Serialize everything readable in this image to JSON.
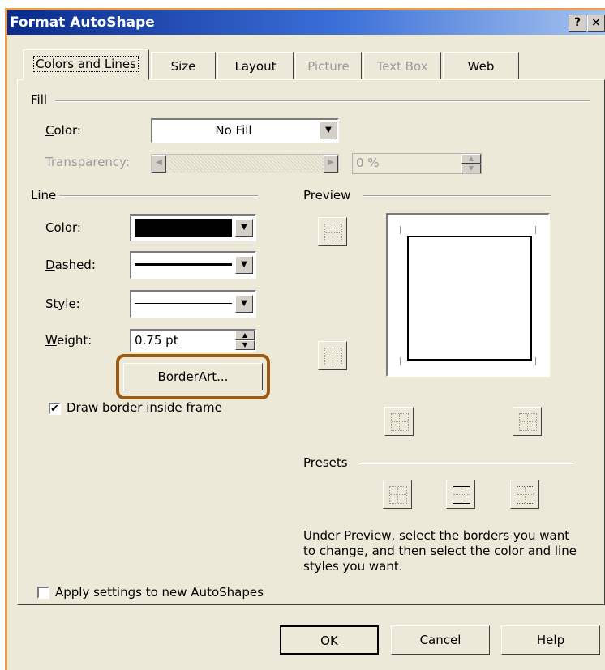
{
  "window": {
    "title": "Format AutoShape",
    "help_label": "?",
    "close_label": "×"
  },
  "tabs": [
    {
      "label": "Colors and Lines",
      "active": true
    },
    {
      "label": "Size"
    },
    {
      "label": "Layout"
    },
    {
      "label": "Picture",
      "disabled": true
    },
    {
      "label": "Text Box",
      "disabled": true
    },
    {
      "label": "Web"
    }
  ],
  "fill": {
    "group_label": "Fill",
    "color_label": "Color:",
    "color_value": "No Fill",
    "transparency_label": "Transparency:",
    "transparency_value": "0 %"
  },
  "line": {
    "group_label": "Line",
    "color_label": "Color:",
    "color_hex": "#000000",
    "dashed_label": "Dashed:",
    "style_label": "Style:",
    "weight_label": "Weight:",
    "weight_value": "0.75 pt",
    "borderart_label": "BorderArt...",
    "draw_inside_label": "Draw border inside frame",
    "draw_inside_checked": "✔"
  },
  "preview": {
    "group_label": "Preview"
  },
  "presets": {
    "group_label": "Presets",
    "help_text": "Under Preview, select the borders you want to change, and then select the color and line styles you want."
  },
  "apply_label": "Apply settings to new AutoShapes",
  "buttons": {
    "ok": "OK",
    "cancel": "Cancel",
    "help": "Help"
  },
  "highlight_color": "#9c5a12"
}
